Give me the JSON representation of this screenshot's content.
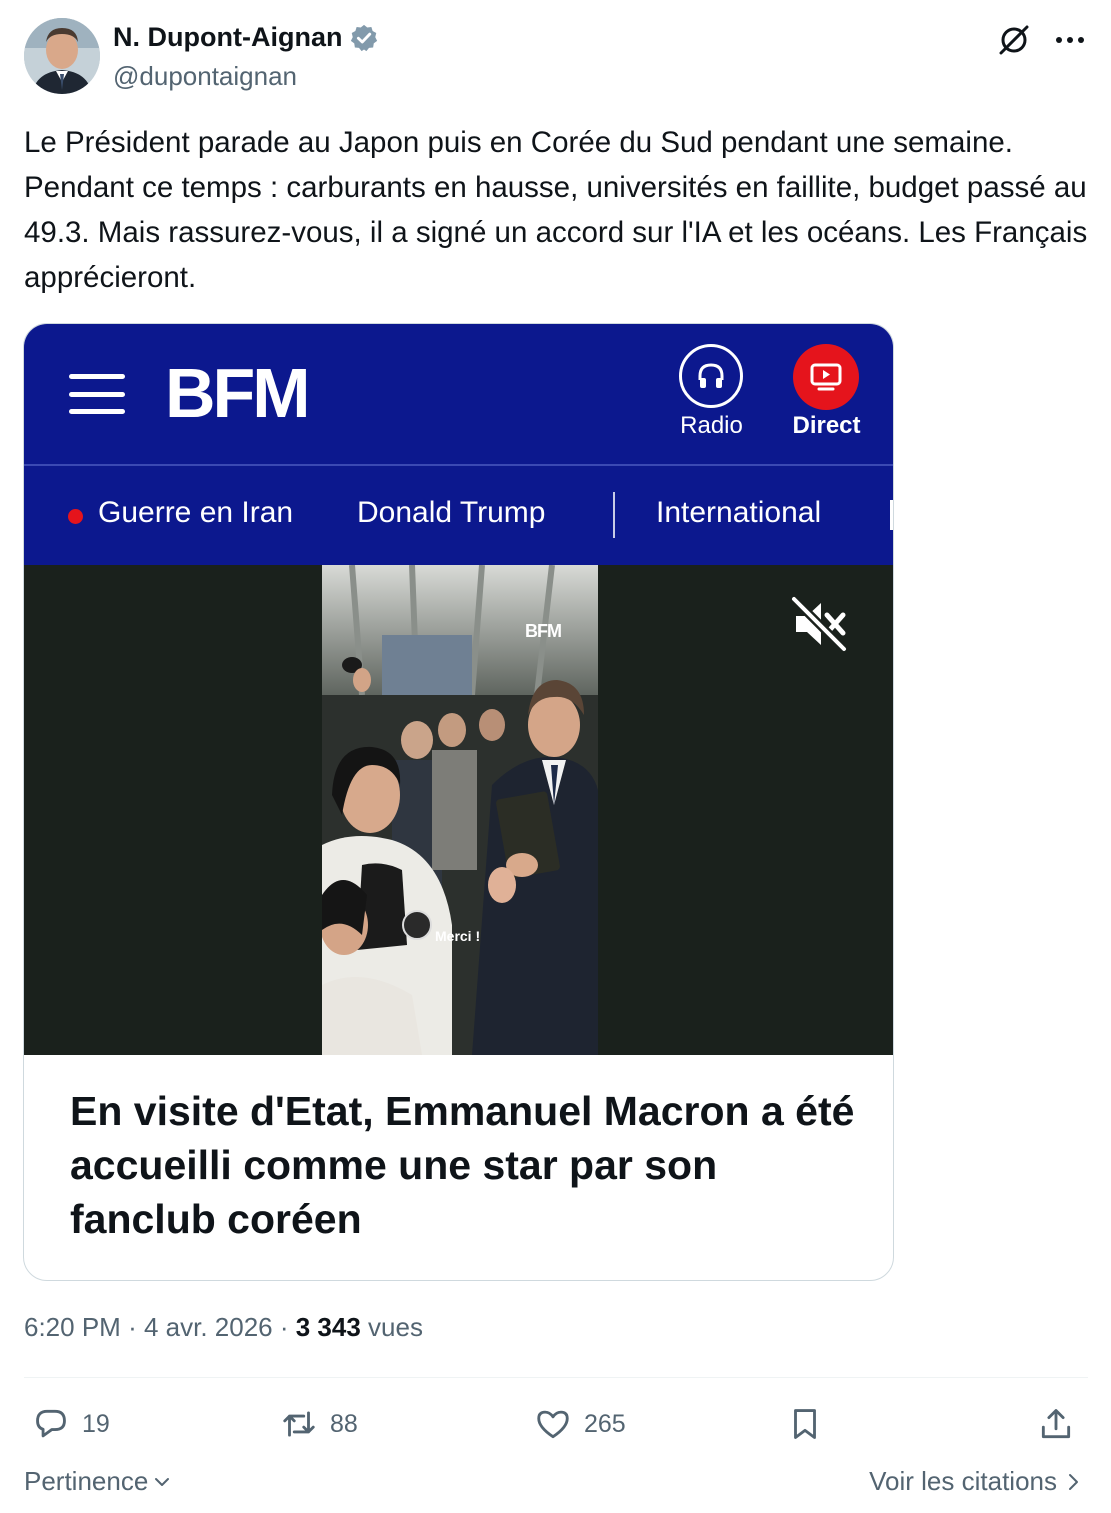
{
  "author": {
    "display_name": "N. Dupont-Aignan",
    "handle": "@dupontaignan",
    "verified": true
  },
  "icons": {
    "verified": "verified-badge-icon",
    "grok": "grok-icon",
    "more": "more-icon",
    "mute": "muted-speaker-icon"
  },
  "tweet": {
    "text": "Le Président parade au Japon puis en Corée du Sud pendant une semaine. Pendant ce temps : carburants en hausse, universités en faillite, budget passé au 49.3. Mais rassurez-vous, il a signé un accord sur l'IA et les océans. Les Français apprécieront."
  },
  "card": {
    "brand": "BFM",
    "radio_label": "Radio",
    "direct_label": "Direct",
    "nav": [
      {
        "label": "Guerre en Iran"
      },
      {
        "label": "Donald Trump"
      },
      {
        "label": "International"
      }
    ],
    "video": {
      "watermark": "BFM",
      "caption": "Merci !"
    },
    "headline": "En visite d'Etat, Emmanuel Macron a été accueilli comme une star par son fanclub coréen"
  },
  "meta": {
    "time": "6:20 PM",
    "date": "4 avr. 2026",
    "views": "3 343",
    "views_label": "vues"
  },
  "actions": {
    "replies": "19",
    "reposts": "88",
    "likes": "265"
  },
  "footer": {
    "sort_label": "Pertinence",
    "quotes_label": "Voir les citations"
  },
  "colors": {
    "bfm_blue": "#0c188e",
    "live_red": "#e5141c",
    "verified_blue": "#829aab",
    "secondary_text": "#536471"
  }
}
